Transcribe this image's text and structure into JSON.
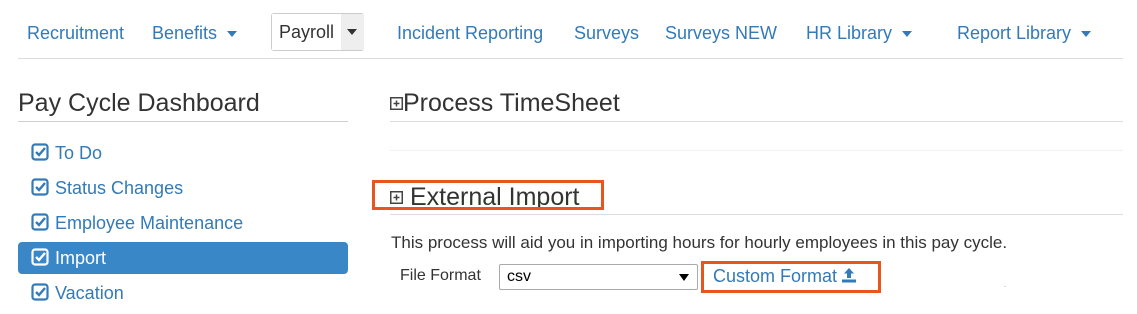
{
  "topnav": {
    "recruitment": "Recruitment",
    "benefits": "Benefits",
    "payroll": "Payroll",
    "incident_reporting": "Incident Reporting",
    "surveys": "Surveys",
    "surveys_new": "Surveys NEW",
    "hr_library": "HR Library",
    "report_library": "Report Library"
  },
  "sidebar": {
    "title": "Pay Cycle Dashboard",
    "items": [
      {
        "label": "To Do",
        "active": false
      },
      {
        "label": "Status Changes",
        "active": false
      },
      {
        "label": "Employee Maintenance",
        "active": false
      },
      {
        "label": "Import",
        "active": true
      },
      {
        "label": "Vacation",
        "active": false
      }
    ]
  },
  "main": {
    "process_timesheet": "Process TimeSheet",
    "external_import": "External Import",
    "description": "This process will aid you in importing hours for hourly employees in this pay cycle.",
    "file_format_label": "File Format",
    "file_format_value": "csv",
    "custom_format": "Custom Format"
  },
  "colors": {
    "link": "#337ab7",
    "active_bg": "#3a87c8",
    "highlight": "#e8561f"
  },
  "icons": {
    "check": "check-square-icon",
    "expand": "plus-square-icon",
    "upload": "upload-icon",
    "caret": "caret-down-icon"
  }
}
